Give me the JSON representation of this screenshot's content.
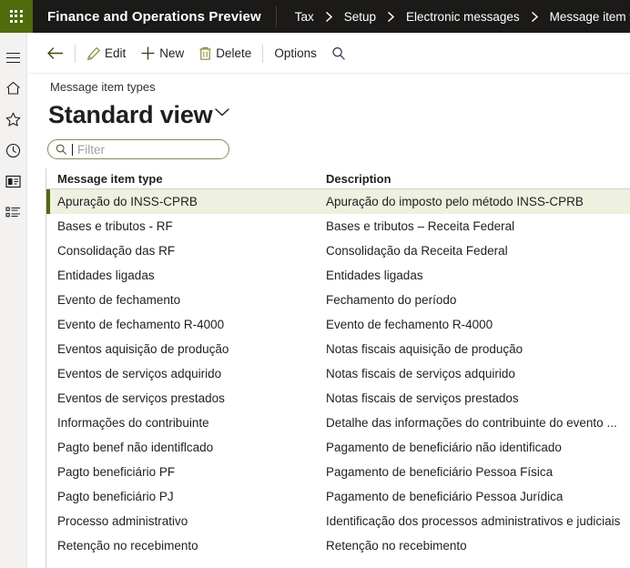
{
  "topbar": {
    "waffle_icon": "waffle-grid-icon",
    "app_title": "Finance and Operations Preview",
    "breadcrumb": [
      {
        "label": "Tax"
      },
      {
        "label": "Setup"
      },
      {
        "label": "Electronic messages"
      },
      {
        "label": "Message item types"
      }
    ],
    "separator_icon": "chevron-right-icon",
    "background": "#1b1a19",
    "waffle_background": "#4f6b0b"
  },
  "rail": {
    "items": [
      {
        "icon": "hamburger-menu-icon",
        "name": "navigation-menu"
      },
      {
        "icon": "home-icon",
        "name": "home"
      },
      {
        "icon": "star-icon",
        "name": "favorites"
      },
      {
        "icon": "clock-icon",
        "name": "recent"
      },
      {
        "icon": "workspace-icon",
        "name": "workspaces"
      },
      {
        "icon": "modules-list-icon",
        "name": "modules"
      }
    ]
  },
  "toolbar": {
    "back_icon": "back-arrow-icon",
    "edit_label": "Edit",
    "edit_icon": "pencil-icon",
    "new_label": "New",
    "new_icon": "plus-icon",
    "delete_label": "Delete",
    "delete_icon": "trash-icon",
    "options_label": "Options",
    "search_icon": "search-icon",
    "accent_color": "#7a8b3c"
  },
  "page": {
    "caption": "Message item types",
    "title": "Standard view",
    "title_chevron_icon": "chevron-down-icon"
  },
  "filter": {
    "icon": "search-icon",
    "value": "",
    "placeholder": "Filter"
  },
  "grid": {
    "columns": [
      {
        "key": "type",
        "header": "Message item type"
      },
      {
        "key": "description",
        "header": "Description"
      }
    ],
    "selected_row_index": 0,
    "selected_background": "#eef0e0",
    "selected_marker_color": "#4f6b0b",
    "rows": [
      {
        "type": "Apuração do INSS-CPRB",
        "description": "Apuração do imposto pelo método INSS-CPRB"
      },
      {
        "type": "Bases e tributos - RF",
        "description": "Bases e tributos – Receita Federal"
      },
      {
        "type": "Consolidação das RF",
        "description": "Consolidação da Receita Federal"
      },
      {
        "type": "Entidades ligadas",
        "description": "Entidades ligadas"
      },
      {
        "type": "Evento de fechamento",
        "description": "Fechamento do período"
      },
      {
        "type": "Evento de fechamento R-4000",
        "description": "Evento de fechamento R-4000"
      },
      {
        "type": "Eventos aquisição de produção",
        "description": "Notas fiscais aquisição de produção"
      },
      {
        "type": "Eventos de serviços adquirido",
        "description": "Notas fiscais de serviços adquirido"
      },
      {
        "type": "Eventos de serviços prestados",
        "description": "Notas fiscais de serviços prestados"
      },
      {
        "type": "Informações do contribuinte",
        "description": "Detalhe das informações do contribuinte do evento ..."
      },
      {
        "type": "Pagto benef não identiflcado",
        "description": "Pagamento de beneficiário não identificado"
      },
      {
        "type": "Pagto beneficiário PF",
        "description": "Pagamento de beneficiário Pessoa Física"
      },
      {
        "type": "Pagto beneficiário PJ",
        "description": "Pagamento de beneficiário Pessoa Jurídica"
      },
      {
        "type": "Processo administrativo",
        "description": "Identificação dos processos administrativos e judiciais"
      },
      {
        "type": "Retenção no recebimento",
        "description": "Retenção no recebimento"
      }
    ]
  }
}
